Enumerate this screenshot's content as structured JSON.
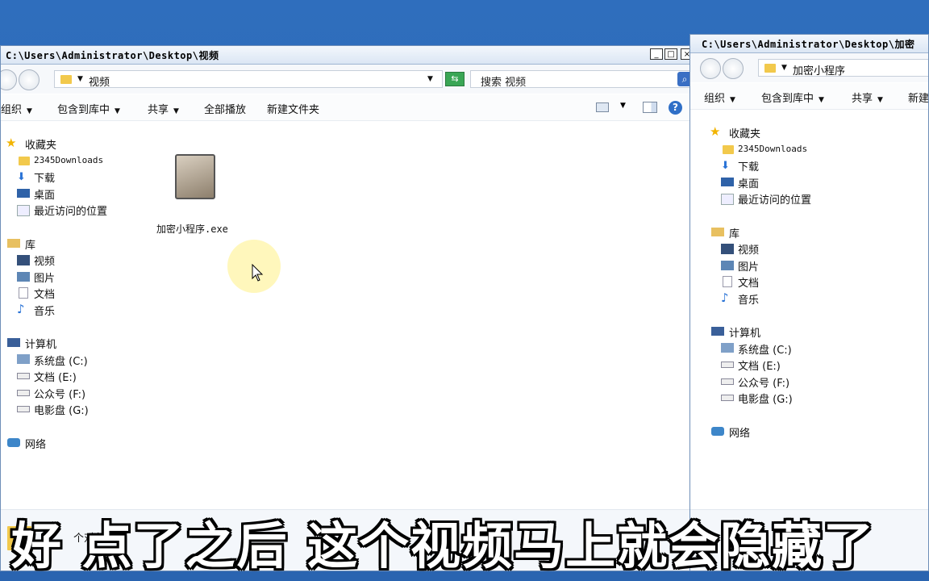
{
  "left_window": {
    "title": "C:\\Users\\Administrator\\Desktop\\视频",
    "address": "视频",
    "search_placeholder": "搜索 视频",
    "toolbar": {
      "organize": "组织",
      "include_library": "包含到库中",
      "share": "共享",
      "play_all": "全部播放",
      "new_folder": "新建文件夹"
    },
    "nav": {
      "favorites": "收藏夹",
      "fav_items": [
        "2345Downloads",
        "下载",
        "桌面",
        "最近访问的位置"
      ],
      "libraries": "库",
      "lib_items": [
        "视频",
        "图片",
        "文档",
        "音乐"
      ],
      "computer": "计算机",
      "drives": [
        "系统盘 (C:)",
        "文档 (E:)",
        "公众号 (F:)",
        "电影盘 (G:)"
      ],
      "network": "网络"
    },
    "file": {
      "name": "加密小程序.exe"
    },
    "status": "个对象"
  },
  "right_window": {
    "title": "C:\\Users\\Administrator\\Desktop\\加密",
    "address": "加密小程序",
    "toolbar": {
      "organize": "组织",
      "include_library": "包含到库中",
      "share": "共享",
      "new_partial": "新建"
    },
    "nav": {
      "favorites": "收藏夹",
      "fav_items": [
        "2345Downloads",
        "下载",
        "桌面",
        "最近访问的位置"
      ],
      "libraries": "库",
      "lib_items": [
        "视频",
        "图片",
        "文档",
        "音乐"
      ],
      "computer": "计算机",
      "drives": [
        "系统盘 (C:)",
        "文档 (E:)",
        "公众号 (F:)",
        "电影盘 (G:)"
      ],
      "network": "网络"
    }
  },
  "subtitle": "好  点了之后  这个视频马上就会隐藏了",
  "colors": {
    "desktop": "#2a64b0",
    "window_border": "#6f8fb8",
    "folder": "#f2c94c",
    "cursor_highlight": "#fff6b0"
  }
}
